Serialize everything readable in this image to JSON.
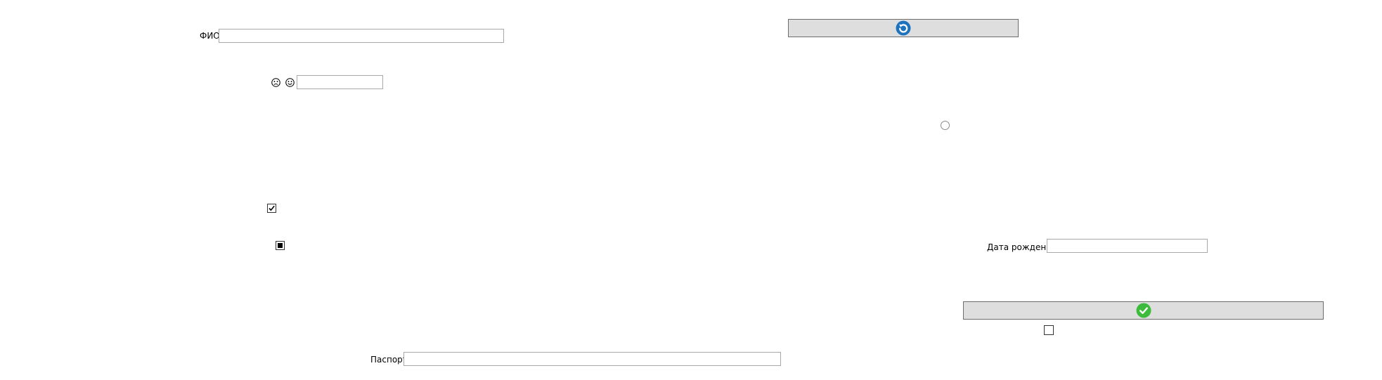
{
  "form": {
    "fio_label": "ФИО",
    "fio_value": "",
    "emoji_field_value": "",
    "passport_label": "Паспорт",
    "passport_value": "",
    "birthdate_label": "Дата рождения",
    "birthdate_value": ""
  },
  "buttons": {
    "refresh_icon": "refresh-icon",
    "confirm_icon": "checkmark-icon"
  },
  "controls": {
    "checkbox_checked": true,
    "checkbox_indeterminate": true,
    "checkbox_unchecked": false,
    "radio_selected": false
  },
  "colors": {
    "button_bg": "#dedede",
    "refresh_icon": "#1e73be",
    "confirm_icon": "#3dbb3d"
  }
}
